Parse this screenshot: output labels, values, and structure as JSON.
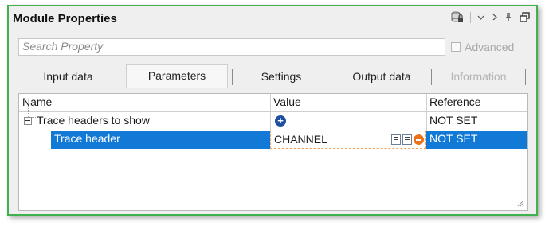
{
  "window": {
    "title": "Module Properties",
    "title_icons": [
      "database-lock-icon",
      "chevron-down-icon",
      "chevron-right-icon",
      "pin-icon",
      "restore-icon"
    ],
    "colors": {
      "frame": "#3fb24f",
      "selection": "#1279d6",
      "edit_border": "#f0a060"
    }
  },
  "search": {
    "placeholder": "Search Property"
  },
  "advanced": {
    "label": "Advanced",
    "checked": false,
    "enabled": false
  },
  "tabs": [
    {
      "label": "Input data"
    },
    {
      "label": "Parameters",
      "active": true
    },
    {
      "label": "Settings"
    },
    {
      "label": "Output data"
    },
    {
      "label": "Information",
      "disabled": true
    }
  ],
  "grid": {
    "columns": {
      "name": "Name",
      "value": "Value",
      "reference": "Reference"
    },
    "rows": [
      {
        "name": "Trace headers to show",
        "value": "",
        "reference": "NOT SET"
      },
      {
        "name": "Trace header",
        "value": "CHANNEL",
        "reference": "NOT SET",
        "selected": true
      }
    ]
  }
}
